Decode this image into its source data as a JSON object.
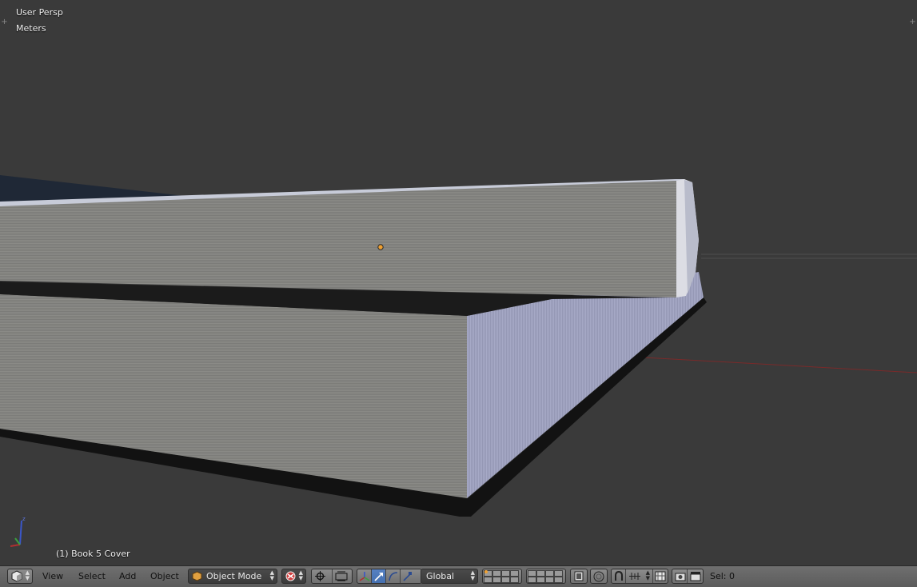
{
  "viewport": {
    "view_name": "User Persp",
    "units": "Meters",
    "active_object": "(1) Book 5 Cover"
  },
  "header": {
    "menus": [
      "View",
      "Select",
      "Add",
      "Object"
    ],
    "mode": "Object Mode",
    "orientation": "Global",
    "selection": "Sel: 0"
  },
  "colors": {
    "background": "#3a3a3a",
    "header": "#666666",
    "active_button": "#5680c2",
    "x_axis": "#8a2a2a",
    "origin_dot": "#f0a030"
  }
}
